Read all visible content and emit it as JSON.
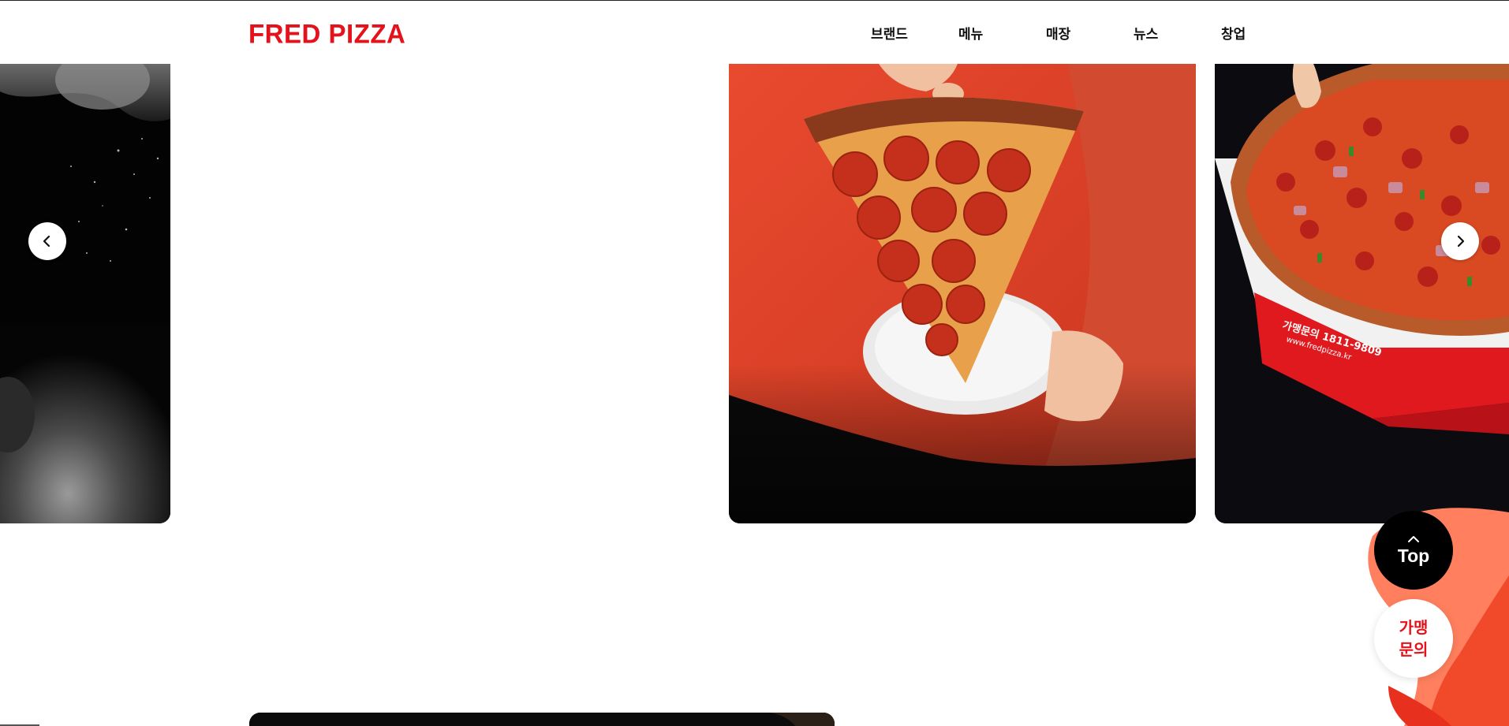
{
  "header": {
    "logo": "FRED PIZZA",
    "nav": [
      "브랜드",
      "메뉴",
      "매장",
      "뉴스",
      "창업"
    ]
  },
  "slider": {
    "prev_icon": "chevron-left-icon",
    "next_icon": "chevron-right-icon",
    "box_print_line1": "가맹문의 1811-9809",
    "box_print_line2": "www.fredpizza.kr"
  },
  "floating": {
    "top_label": "Top",
    "top_icon": "chevron-up-icon",
    "franchise_label": "가맹 문의"
  },
  "colors": {
    "brand_red": "#e3121b",
    "slide_red": "#e8412a",
    "deco_coral": "#ff7f5e"
  }
}
